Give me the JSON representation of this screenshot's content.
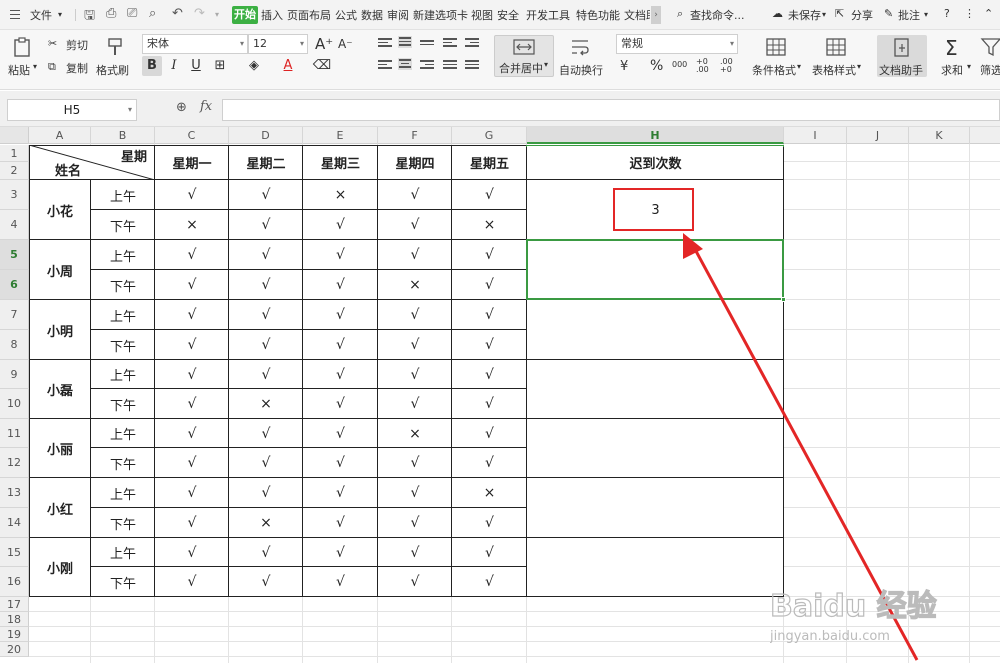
{
  "menubar": {
    "file": "文件",
    "tabs": [
      "开始",
      "插入",
      "页面布局",
      "公式",
      "数据",
      "审阅",
      "新建选项卡",
      "视图",
      "安全",
      "开发工具",
      "特色功能",
      "文档助"
    ],
    "search": "查找命令...",
    "unsaved": "未保存",
    "share": "分享",
    "comment": "批注",
    "help": "?"
  },
  "ribbon": {
    "paste": "粘贴",
    "cut": "剪切",
    "copy": "复制",
    "format_painter": "格式刷",
    "font_name": "宋体",
    "font_size": "12",
    "merge_center": "合并居中",
    "wrap_text": "自动换行",
    "number_format": "常规",
    "conditional_format": "条件格式",
    "table_style": "表格样式",
    "doc_helper": "文档助手",
    "sum": "求和",
    "filter": "筛选",
    "percent": "%",
    "thousands": "000",
    "inc_dec": "+0 .00",
    "dec_dec": ".00 +0"
  },
  "formula_bar": {
    "cell_ref": "H5",
    "fx": "fx",
    "value": ""
  },
  "columns": [
    "A",
    "B",
    "C",
    "D",
    "E",
    "F",
    "G",
    "H",
    "I",
    "J",
    "K"
  ],
  "rows": [
    "1",
    "2",
    "3",
    "4",
    "5",
    "6",
    "7",
    "8",
    "9",
    "10",
    "11",
    "12",
    "13",
    "14",
    "15",
    "16",
    "17",
    "18",
    "19",
    "20"
  ],
  "table": {
    "corner_week": "星期",
    "corner_name": "姓名",
    "days": [
      "星期一",
      "星期二",
      "星期三",
      "星期四",
      "星期五"
    ],
    "late_header": "迟到次数",
    "am": "上午",
    "pm": "下午",
    "people": [
      {
        "name": "小花",
        "late": "3",
        "am": [
          "√",
          "√",
          "×",
          "√",
          "√"
        ],
        "pm": [
          "×",
          "√",
          "√",
          "√",
          "×"
        ]
      },
      {
        "name": "小周",
        "late": "",
        "am": [
          "√",
          "√",
          "√",
          "√",
          "√"
        ],
        "pm": [
          "√",
          "√",
          "√",
          "×",
          "√"
        ]
      },
      {
        "name": "小明",
        "late": "",
        "am": [
          "√",
          "√",
          "√",
          "√",
          "√"
        ],
        "pm": [
          "√",
          "√",
          "√",
          "√",
          "√"
        ]
      },
      {
        "name": "小磊",
        "late": "",
        "am": [
          "√",
          "√",
          "√",
          "√",
          "√"
        ],
        "pm": [
          "√",
          "×",
          "√",
          "√",
          "√"
        ]
      },
      {
        "name": "小丽",
        "late": "",
        "am": [
          "√",
          "√",
          "√",
          "×",
          "√"
        ],
        "pm": [
          "√",
          "√",
          "√",
          "√",
          "√"
        ]
      },
      {
        "name": "小红",
        "late": "",
        "am": [
          "√",
          "√",
          "√",
          "√",
          "×"
        ],
        "pm": [
          "√",
          "×",
          "√",
          "√",
          "√"
        ]
      },
      {
        "name": "小刚",
        "late": "",
        "am": [
          "√",
          "√",
          "√",
          "√",
          "√"
        ],
        "pm": [
          "√",
          "√",
          "√",
          "√",
          "√"
        ]
      }
    ]
  },
  "watermark": {
    "logo": "Baidu 经验",
    "url": "jingyan.baidu.com"
  },
  "colors": {
    "selection": "#3a9a42",
    "annotation": "#e32626",
    "ribbon_tab_active": "#3cb043"
  }
}
